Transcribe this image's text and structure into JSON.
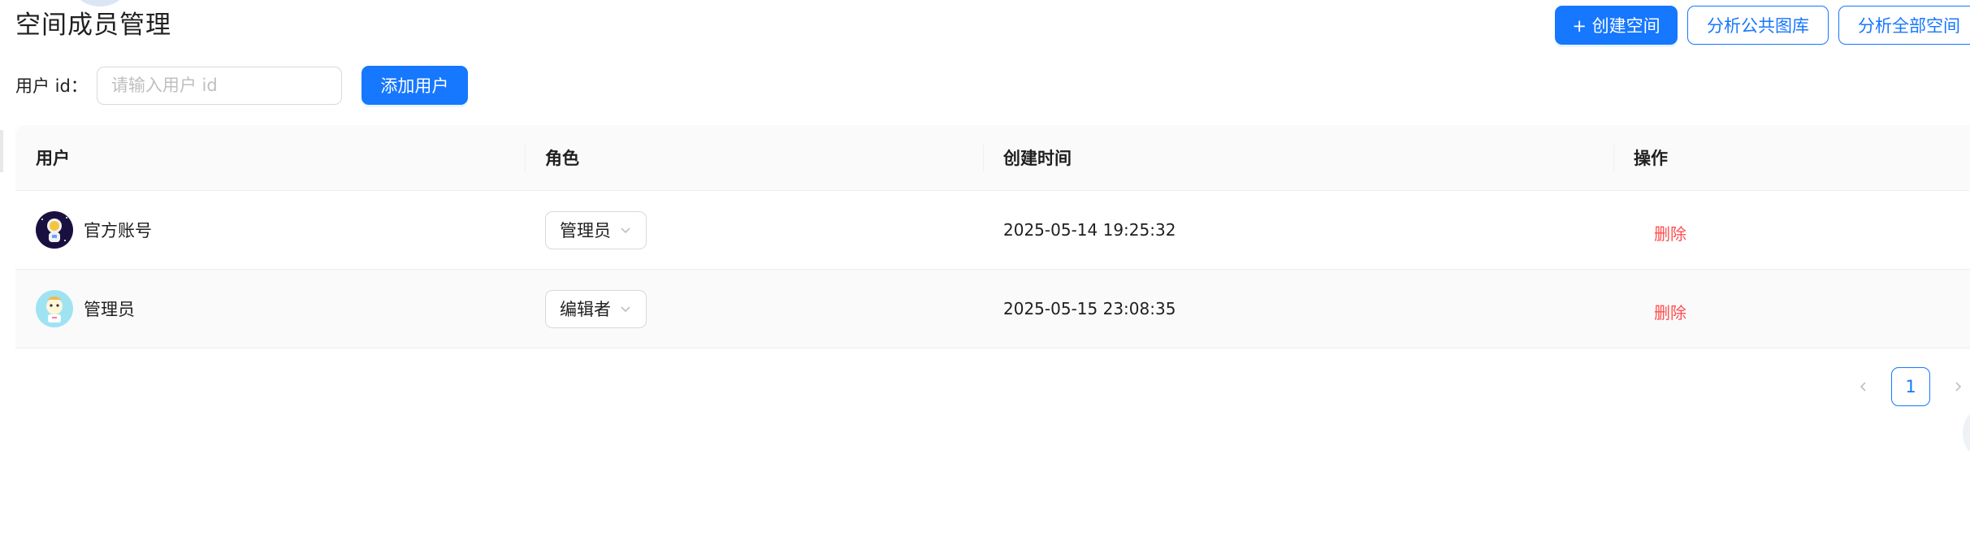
{
  "page": {
    "title": "空间成员管理"
  },
  "header_actions": {
    "create_space_label": "+ 创建空间",
    "analyze_public_label": "分析公共图库",
    "analyze_all_label": "分析全部空间"
  },
  "add_user_form": {
    "label": "用户 id：",
    "input_value": "",
    "input_placeholder": "请输入用户 id",
    "submit_label": "添加用户"
  },
  "table": {
    "columns": [
      "用户",
      "角色",
      "创建时间",
      "操作"
    ],
    "rows": [
      {
        "user_name": "官方账号",
        "avatar_icon": "astronaut-avatar-icon",
        "role": "管理员",
        "created_time": "2025-05-14 19:25:32",
        "action": "删除"
      },
      {
        "user_name": "管理员",
        "avatar_icon": "cartoon-avatar-icon",
        "role": "编辑者",
        "created_time": "2025-05-15 23:08:35",
        "action": "删除"
      }
    ]
  },
  "pagination": {
    "current_page": "1"
  },
  "colors": {
    "primary": "#1677ff",
    "danger": "#ff4d4f",
    "header_bg": "#fafafa",
    "border": "#d9d9d9"
  }
}
